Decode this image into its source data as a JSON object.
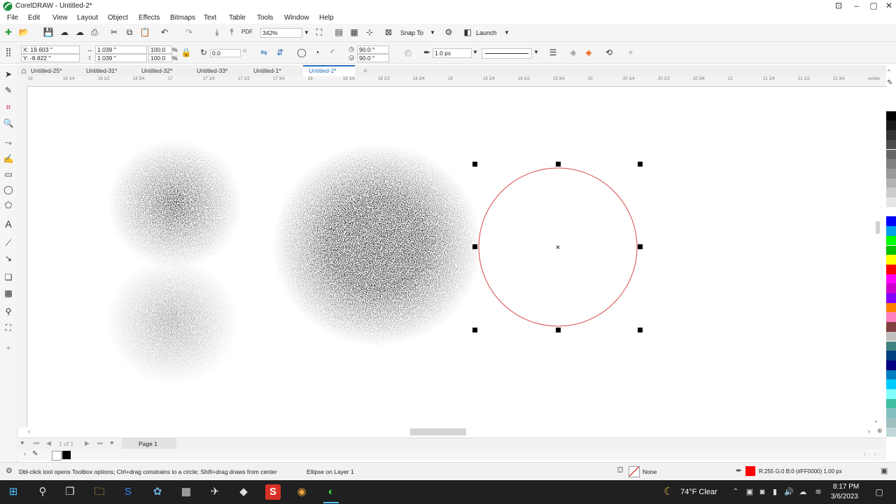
{
  "window": {
    "title": "CorelDRAW - Untitled-2*",
    "controls": [
      "restore-icon",
      "minimize-icon",
      "maximize-icon",
      "close-icon"
    ]
  },
  "menu": [
    "File",
    "Edit",
    "View",
    "Layout",
    "Object",
    "Effects",
    "Bitmaps",
    "Text",
    "Table",
    "Tools",
    "Window",
    "Help"
  ],
  "toolbar": {
    "zoom": "342%",
    "snap_to": "Snap To",
    "launch": "Launch"
  },
  "propertybar": {
    "x": "X: 19.603 \"",
    "y": "Y: -8.822 \"",
    "width": "1.039 \"",
    "height": "1.039 \"",
    "scale_x": "100.0",
    "scale_y": "100.0",
    "unit_pct": "%",
    "rotation": "0.0",
    "angle_start": "90.0 °",
    "angle_end": "90.0 °",
    "outline_width": "1.0 px"
  },
  "doc_tabs": [
    "Untitled-25*",
    "Untitled-31*",
    "Untitled-32*",
    "Untitled-33*",
    "Untitled-1*",
    "Untitled-2*"
  ],
  "active_tab": "Untitled-2*",
  "ruler": {
    "ticks": [
      "16",
      "16 1/4",
      "16 1/2",
      "16 3/4",
      "17",
      "17 1/4",
      "17 1/2",
      "17 3/4",
      "18",
      "18 1/4",
      "18 1/2",
      "18 3/4",
      "19",
      "19 1/4",
      "19 1/2",
      "19 3/4",
      "20",
      "20 1/4",
      "20 1/2",
      "20 3/4",
      "21",
      "21 1/4",
      "21 1/2",
      "21 3/4"
    ],
    "unit": "inches"
  },
  "pagebar": {
    "page_counter": "1 of 1",
    "page_tab": "Page 1"
  },
  "status": {
    "hint": "Dbl-click tool opens Toolbox options; Ctrl+drag constrains to a circle; Shift+drag draws from center",
    "object": "Ellipse on Layer 1",
    "fill": "None",
    "outline": "R:255 G:0 B:0 (#FF0000)  1.00 px"
  },
  "taskbar": {
    "weather": "74°F  Clear",
    "time": "8:17 PM",
    "date": "3/6/2023"
  },
  "colors": {
    "accent": "#2a6fb8",
    "selection_outline": "#d64a4a",
    "outline_swatch": "#ff0000"
  },
  "palette": [
    "#ffffff",
    "#000000",
    "#1a1a1a",
    "#333333",
    "#4d4d4d",
    "#666666",
    "#808080",
    "#999999",
    "#b3b3b3",
    "#cccccc",
    "#e6e6e6",
    "#ffffff",
    "#0000ff",
    "#00a0e9",
    "#00ff00",
    "#00c000",
    "#ffff00",
    "#ff0000",
    "#ff00ff",
    "#cc00cc",
    "#8000ff",
    "#ff8000",
    "#ff80c0",
    "#804040",
    "#c0c0c0",
    "#408080",
    "#004080",
    "#000080",
    "#0080c0",
    "#00ccff",
    "#80ffff",
    "#40c0a0",
    "#80c0c0",
    "#a0c0c0",
    "#c0d8d8"
  ]
}
